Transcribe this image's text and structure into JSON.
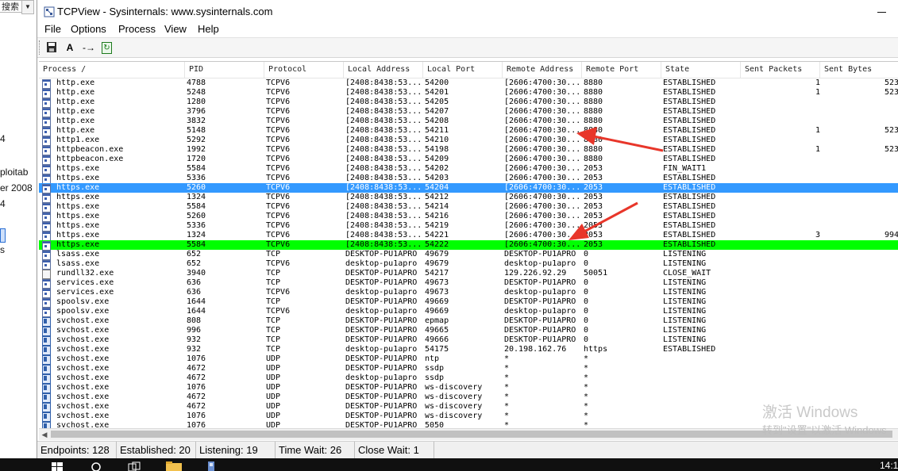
{
  "background_window": {
    "search_box_text": "搜索",
    "fragments": [
      "4",
      "ploitab",
      "er 2008",
      "4",
      "s"
    ]
  },
  "window": {
    "title": "TCPView - Sysinternals: www.sysinternals.com"
  },
  "menu": [
    "File",
    "Options",
    "Process",
    "View",
    "Help"
  ],
  "toolbar": {
    "save_icon": "save-icon",
    "resolve_label": "A",
    "endpoint_label": "-→",
    "refresh_icon": "refresh-icon"
  },
  "columns": [
    "Process  /",
    "PID",
    "Protocol",
    "Local Address",
    "Local Port",
    "Remote Address",
    "Remote Port",
    "State",
    "Sent Packets",
    "Sent Bytes"
  ],
  "rows": [
    {
      "icon": "app",
      "process": "http.exe",
      "pid": "4788",
      "proto": "TCPV6",
      "laddr": "[2408:8438:53...",
      "lport": "54200",
      "raddr": "[2606:4700:30...",
      "rport": "8880",
      "state": "ESTABLISHED",
      "spk": "1",
      "sb": "523"
    },
    {
      "icon": "app",
      "process": "http.exe",
      "pid": "5248",
      "proto": "TCPV6",
      "laddr": "[2408:8438:53...",
      "lport": "54201",
      "raddr": "[2606:4700:30...",
      "rport": "8880",
      "state": "ESTABLISHED",
      "spk": "1",
      "sb": "523"
    },
    {
      "icon": "app",
      "process": "http.exe",
      "pid": "1280",
      "proto": "TCPV6",
      "laddr": "[2408:8438:53...",
      "lport": "54205",
      "raddr": "[2606:4700:30...",
      "rport": "8880",
      "state": "ESTABLISHED",
      "spk": "",
      "sb": ""
    },
    {
      "icon": "app",
      "process": "http.exe",
      "pid": "3796",
      "proto": "TCPV6",
      "laddr": "[2408:8438:53...",
      "lport": "54207",
      "raddr": "[2606:4700:30...",
      "rport": "8880",
      "state": "ESTABLISHED",
      "spk": "",
      "sb": ""
    },
    {
      "icon": "app",
      "process": "http.exe",
      "pid": "3832",
      "proto": "TCPV6",
      "laddr": "[2408:8438:53...",
      "lport": "54208",
      "raddr": "[2606:4700:30...",
      "rport": "8880",
      "state": "ESTABLISHED",
      "spk": "",
      "sb": ""
    },
    {
      "icon": "app",
      "process": "http.exe",
      "pid": "5148",
      "proto": "TCPV6",
      "laddr": "[2408:8438:53...",
      "lport": "54211",
      "raddr": "[2606:4700:30...",
      "rport": "8880",
      "state": "ESTABLISHED",
      "spk": "1",
      "sb": "523"
    },
    {
      "icon": "app",
      "process": "http1.exe",
      "pid": "5292",
      "proto": "TCPV6",
      "laddr": "[2408:8438:53...",
      "lport": "54210",
      "raddr": "[2606:4700:30...",
      "rport": "8880",
      "state": "ESTABLISHED",
      "spk": "",
      "sb": ""
    },
    {
      "icon": "app",
      "process": "httpbeacon.exe",
      "pid": "1992",
      "proto": "TCPV6",
      "laddr": "[2408:8438:53...",
      "lport": "54198",
      "raddr": "[2606:4700:30...",
      "rport": "8880",
      "state": "ESTABLISHED",
      "spk": "1",
      "sb": "523"
    },
    {
      "icon": "app",
      "process": "httpbeacon.exe",
      "pid": "1720",
      "proto": "TCPV6",
      "laddr": "[2408:8438:53...",
      "lport": "54209",
      "raddr": "[2606:4700:30...",
      "rport": "8880",
      "state": "ESTABLISHED",
      "spk": "",
      "sb": ""
    },
    {
      "icon": "app",
      "process": "https.exe",
      "pid": "5584",
      "proto": "TCPV6",
      "laddr": "[2408:8438:53...",
      "lport": "54202",
      "raddr": "[2606:4700:30...",
      "rport": "2053",
      "state": "FIN_WAIT1",
      "spk": "",
      "sb": ""
    },
    {
      "icon": "app",
      "process": "https.exe",
      "pid": "5336",
      "proto": "TCPV6",
      "laddr": "[2408:8438:53...",
      "lport": "54203",
      "raddr": "[2606:4700:30...",
      "rport": "2053",
      "state": "ESTABLISHED",
      "spk": "",
      "sb": ""
    },
    {
      "icon": "app",
      "process": "https.exe",
      "pid": "5260",
      "proto": "TCPV6",
      "laddr": "[2408:8438:53...",
      "lport": "54204",
      "raddr": "[2606:4700:30...",
      "rport": "2053",
      "state": "ESTABLISHED",
      "spk": "",
      "sb": "",
      "highlight": "blue"
    },
    {
      "icon": "app",
      "process": "https.exe",
      "pid": "1324",
      "proto": "TCPV6",
      "laddr": "[2408:8438:53...",
      "lport": "54212",
      "raddr": "[2606:4700:30...",
      "rport": "2053",
      "state": "ESTABLISHED",
      "spk": "",
      "sb": ""
    },
    {
      "icon": "app",
      "process": "https.exe",
      "pid": "5584",
      "proto": "TCPV6",
      "laddr": "[2408:8438:53...",
      "lport": "54214",
      "raddr": "[2606:4700:30...",
      "rport": "2053",
      "state": "ESTABLISHED",
      "spk": "",
      "sb": ""
    },
    {
      "icon": "app",
      "process": "https.exe",
      "pid": "5260",
      "proto": "TCPV6",
      "laddr": "[2408:8438:53...",
      "lport": "54216",
      "raddr": "[2606:4700:30...",
      "rport": "2053",
      "state": "ESTABLISHED",
      "spk": "",
      "sb": ""
    },
    {
      "icon": "app",
      "process": "https.exe",
      "pid": "5336",
      "proto": "TCPV6",
      "laddr": "[2408:8438:53...",
      "lport": "54219",
      "raddr": "[2606:4700:30...",
      "rport": "2053",
      "state": "ESTABLISHED",
      "spk": "",
      "sb": ""
    },
    {
      "icon": "app",
      "process": "https.exe",
      "pid": "1324",
      "proto": "TCPV6",
      "laddr": "[2408:8438:53...",
      "lport": "54221",
      "raddr": "[2606:4700:30...",
      "rport": "2053",
      "state": "ESTABLISHED",
      "spk": "3",
      "sb": "994"
    },
    {
      "icon": "app",
      "process": "https.exe",
      "pid": "5584",
      "proto": "TCPV6",
      "laddr": "[2408:8438:53...",
      "lport": "54222",
      "raddr": "[2606:4700:30...",
      "rport": "2053",
      "state": "ESTABLISHED",
      "spk": "",
      "sb": "",
      "highlight": "green"
    },
    {
      "icon": "app",
      "process": "lsass.exe",
      "pid": "652",
      "proto": "TCP",
      "laddr": "DESKTOP-PU1APRO",
      "lport": "49679",
      "raddr": "DESKTOP-PU1APRO",
      "rport": "0",
      "state": "LISTENING",
      "spk": "",
      "sb": ""
    },
    {
      "icon": "app",
      "process": "lsass.exe",
      "pid": "652",
      "proto": "TCPV6",
      "laddr": "desktop-pu1apro",
      "lport": "49679",
      "raddr": "desktop-pu1apro",
      "rport": "0",
      "state": "LISTENING",
      "spk": "",
      "sb": ""
    },
    {
      "icon": "doc",
      "process": "rundll32.exe",
      "pid": "3940",
      "proto": "TCP",
      "laddr": "DESKTOP-PU1APRO",
      "lport": "54217",
      "raddr": "129.226.92.29",
      "rport": "50051",
      "state": "CLOSE_WAIT",
      "spk": "",
      "sb": ""
    },
    {
      "icon": "app",
      "process": "services.exe",
      "pid": "636",
      "proto": "TCP",
      "laddr": "DESKTOP-PU1APRO",
      "lport": "49673",
      "raddr": "DESKTOP-PU1APRO",
      "rport": "0",
      "state": "LISTENING",
      "spk": "",
      "sb": ""
    },
    {
      "icon": "app",
      "process": "services.exe",
      "pid": "636",
      "proto": "TCPV6",
      "laddr": "desktop-pu1apro",
      "lport": "49673",
      "raddr": "desktop-pu1apro",
      "rport": "0",
      "state": "LISTENING",
      "spk": "",
      "sb": ""
    },
    {
      "icon": "app",
      "process": "spoolsv.exe",
      "pid": "1644",
      "proto": "TCP",
      "laddr": "DESKTOP-PU1APRO",
      "lport": "49669",
      "raddr": "DESKTOP-PU1APRO",
      "rport": "0",
      "state": "LISTENING",
      "spk": "",
      "sb": ""
    },
    {
      "icon": "app",
      "process": "spoolsv.exe",
      "pid": "1644",
      "proto": "TCPV6",
      "laddr": "desktop-pu1apro",
      "lport": "49669",
      "raddr": "desktop-pu1apro",
      "rport": "0",
      "state": "LISTENING",
      "spk": "",
      "sb": ""
    },
    {
      "icon": "svc",
      "process": "svchost.exe",
      "pid": "808",
      "proto": "TCP",
      "laddr": "DESKTOP-PU1APRO",
      "lport": "epmap",
      "raddr": "DESKTOP-PU1APRO",
      "rport": "0",
      "state": "LISTENING",
      "spk": "",
      "sb": ""
    },
    {
      "icon": "svc",
      "process": "svchost.exe",
      "pid": "996",
      "proto": "TCP",
      "laddr": "DESKTOP-PU1APRO",
      "lport": "49665",
      "raddr": "DESKTOP-PU1APRO",
      "rport": "0",
      "state": "LISTENING",
      "spk": "",
      "sb": ""
    },
    {
      "icon": "svc",
      "process": "svchost.exe",
      "pid": "932",
      "proto": "TCP",
      "laddr": "DESKTOP-PU1APRO",
      "lport": "49666",
      "raddr": "DESKTOP-PU1APRO",
      "rport": "0",
      "state": "LISTENING",
      "spk": "",
      "sb": ""
    },
    {
      "icon": "svc",
      "process": "svchost.exe",
      "pid": "932",
      "proto": "TCP",
      "laddr": "desktop-pu1apro",
      "lport": "54175",
      "raddr": "20.198.162.76",
      "rport": "https",
      "state": "ESTABLISHED",
      "spk": "",
      "sb": ""
    },
    {
      "icon": "svc",
      "process": "svchost.exe",
      "pid": "1076",
      "proto": "UDP",
      "laddr": "DESKTOP-PU1APRO",
      "lport": "ntp",
      "raddr": "*",
      "rport": "*",
      "state": "",
      "spk": "",
      "sb": ""
    },
    {
      "icon": "svc",
      "process": "svchost.exe",
      "pid": "4672",
      "proto": "UDP",
      "laddr": "DESKTOP-PU1APRO",
      "lport": "ssdp",
      "raddr": "*",
      "rport": "*",
      "state": "",
      "spk": "",
      "sb": ""
    },
    {
      "icon": "svc",
      "process": "svchost.exe",
      "pid": "4672",
      "proto": "UDP",
      "laddr": "desktop-pu1apro",
      "lport": "ssdp",
      "raddr": "*",
      "rport": "*",
      "state": "",
      "spk": "",
      "sb": ""
    },
    {
      "icon": "svc",
      "process": "svchost.exe",
      "pid": "1076",
      "proto": "UDP",
      "laddr": "DESKTOP-PU1APRO",
      "lport": "ws-discovery",
      "raddr": "*",
      "rport": "*",
      "state": "",
      "spk": "",
      "sb": ""
    },
    {
      "icon": "svc",
      "process": "svchost.exe",
      "pid": "4672",
      "proto": "UDP",
      "laddr": "DESKTOP-PU1APRO",
      "lport": "ws-discovery",
      "raddr": "*",
      "rport": "*",
      "state": "",
      "spk": "",
      "sb": ""
    },
    {
      "icon": "svc",
      "process": "svchost.exe",
      "pid": "4672",
      "proto": "UDP",
      "laddr": "DESKTOP-PU1APRO",
      "lport": "ws-discovery",
      "raddr": "*",
      "rport": "*",
      "state": "",
      "spk": "",
      "sb": ""
    },
    {
      "icon": "svc",
      "process": "svchost.exe",
      "pid": "1076",
      "proto": "UDP",
      "laddr": "DESKTOP-PU1APRO",
      "lport": "ws-discovery",
      "raddr": "*",
      "rport": "*",
      "state": "",
      "spk": "",
      "sb": ""
    },
    {
      "icon": "svc",
      "process": "svchost.exe",
      "pid": "1076",
      "proto": "UDP",
      "laddr": "DESKTOP-PU1APRO",
      "lport": "5050",
      "raddr": "*",
      "rport": "*",
      "state": "",
      "spk": "",
      "sb": ""
    }
  ],
  "status": {
    "endpoints": "Endpoints: 128",
    "established": "Established: 20",
    "listening": "Listening: 19",
    "time_wait": "Time Wait: 26",
    "close_wait": "Close Wait: 1"
  },
  "watermark": {
    "line1": "激活 Windows",
    "line2": "转到\"设置\"以激活 Windows"
  },
  "taskbar": {
    "clock": "14:1"
  },
  "colors": {
    "selection_blue": "#3399ff",
    "highlight_green": "#00ff00",
    "annotation_arrow": "#e8362a"
  }
}
